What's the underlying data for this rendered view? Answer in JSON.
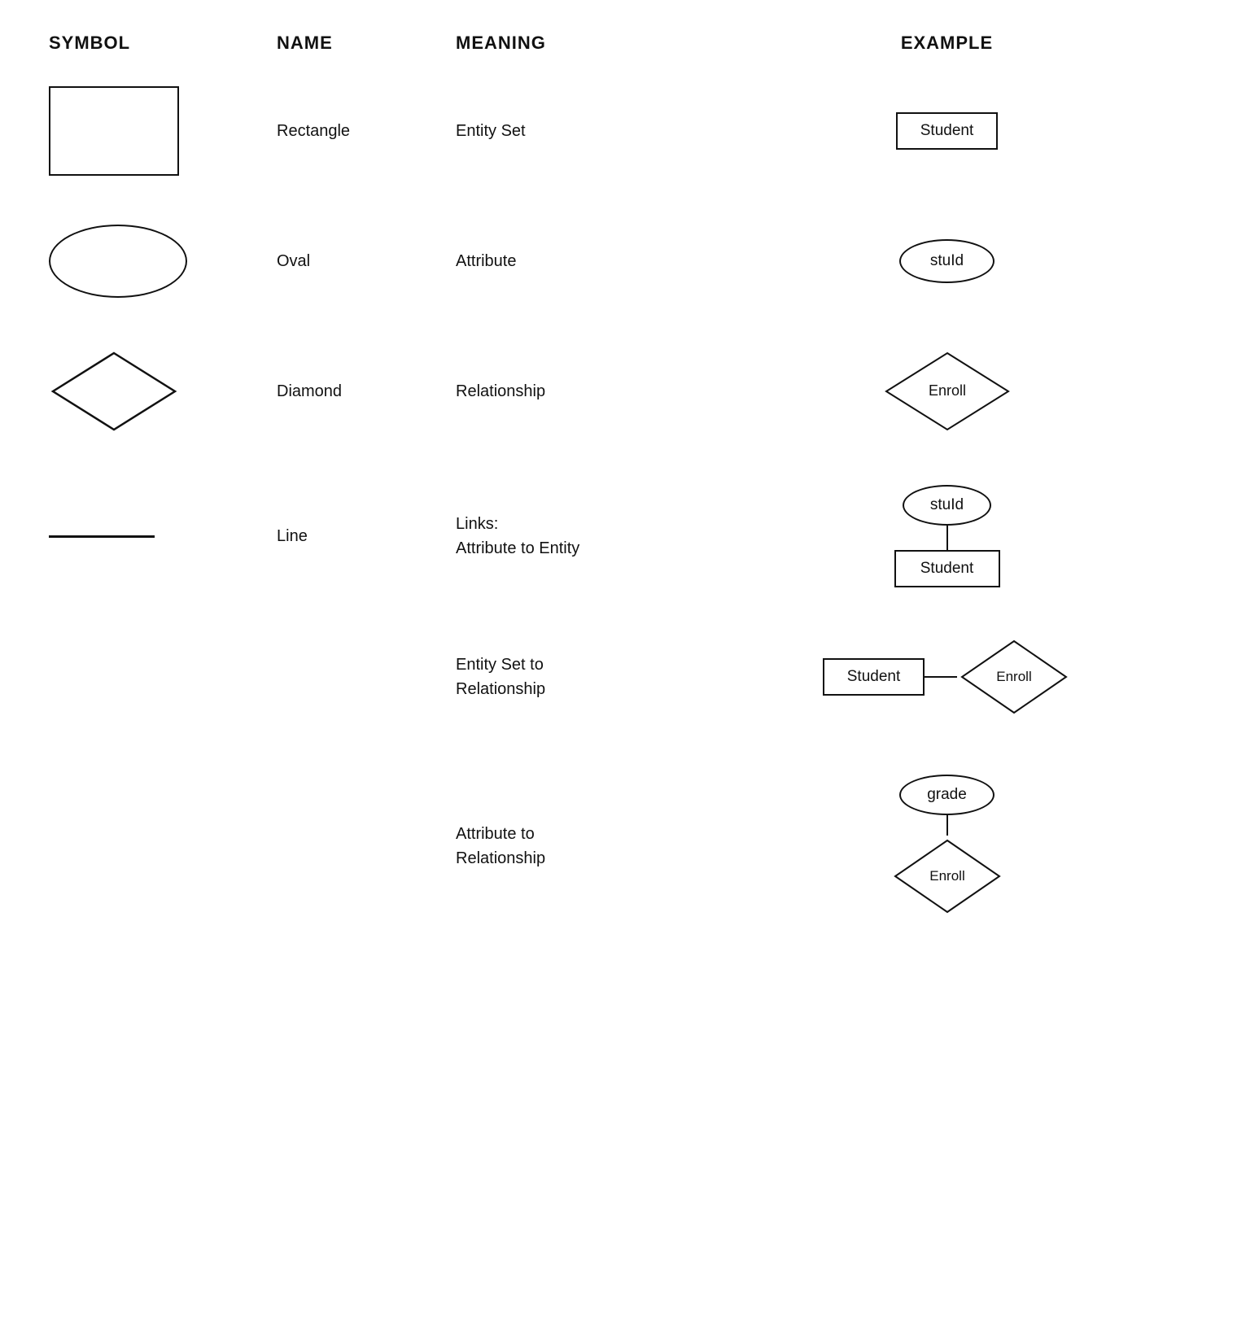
{
  "header": {
    "col1": "SYMBOL",
    "col2": "NAME",
    "col3": "MEANING",
    "col4": "EXAMPLE"
  },
  "rows": [
    {
      "id": "rectangle",
      "name": "Rectangle",
      "meaning": "Entity Set",
      "example_label": "Student",
      "example_type": "rect"
    },
    {
      "id": "oval",
      "name": "Oval",
      "meaning": "Attribute",
      "example_label": "stuId",
      "example_type": "oval"
    },
    {
      "id": "diamond",
      "name": "Diamond",
      "meaning": "Relationship",
      "example_label": "Enroll",
      "example_type": "diamond"
    },
    {
      "id": "line",
      "name": "Line",
      "meaning_line1": "Links:",
      "meaning_line2": "Attribute to Entity",
      "example_type": "line-linked",
      "example_top": "stuId",
      "example_bottom": "Student"
    }
  ],
  "extra_rows": [
    {
      "id": "entity-set-to-relationship",
      "meaning_line1": "Entity Set to",
      "meaning_line2": "Relationship",
      "example_type": "entity-rel",
      "example_left": "Student",
      "example_right": "Enroll"
    },
    {
      "id": "attribute-to-relationship",
      "meaning_line1": "Attribute to",
      "meaning_line2": "Relationship",
      "example_type": "attr-rel",
      "example_top": "grade",
      "example_bottom": "Enroll"
    }
  ]
}
